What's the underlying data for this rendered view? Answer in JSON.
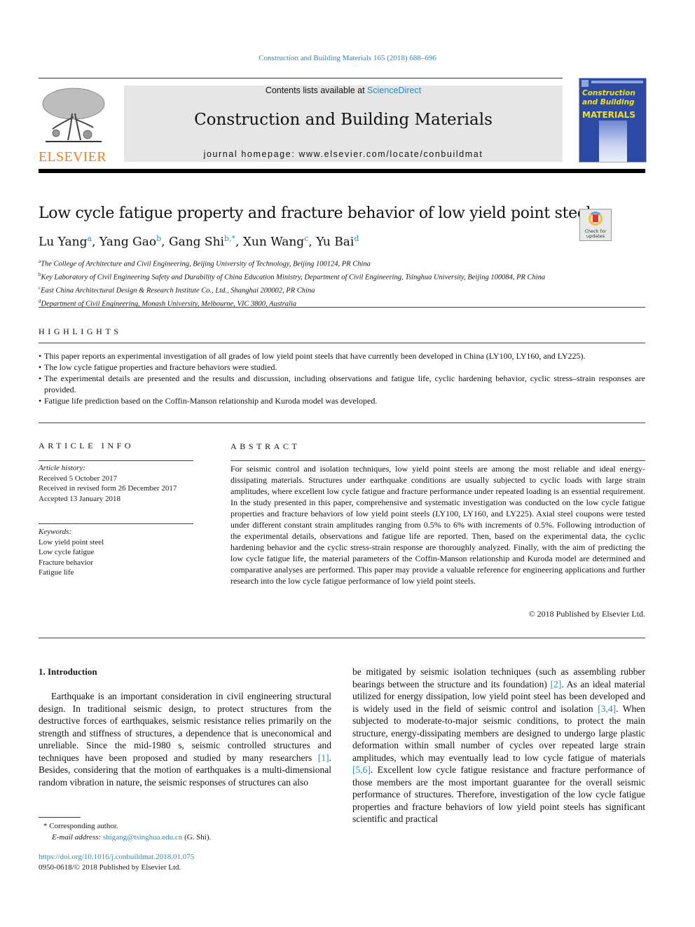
{
  "journal_ref": "Construction and Building Materials 165 (2018) 688–696",
  "header": {
    "publisher_logo": "ELSEVIER",
    "contents_prefix": "Contents lists available at ",
    "contents_link": "ScienceDirect",
    "journal_title": "Construction and Building Materials",
    "homepage": "journal homepage: www.elsevier.com/locate/conbuildmat",
    "cover": {
      "title_line1": "Construction",
      "title_line2": "and Building",
      "title_line3": "MATERIALS",
      "bg_color": "#2c4aa3",
      "title_color": "#f3e31c"
    },
    "publisher_color": "#f07f1d"
  },
  "article": {
    "title": "Low cycle fatigue property and fracture behavior of low yield point steels",
    "check_updates": [
      "Check for",
      "updates"
    ],
    "authors": [
      {
        "name": "Lu Yang",
        "sup": "a"
      },
      {
        "name": "Yang Gao",
        "sup": "b"
      },
      {
        "name": "Gang Shi",
        "sup": "b,*"
      },
      {
        "name": "Xun Wang",
        "sup": "c"
      },
      {
        "name": "Yu Bai",
        "sup": "d"
      }
    ],
    "affiliations": [
      {
        "sup": "a",
        "text": "The College of Architecture and Civil Engineering, Beijing University of Technology, Beijing 100124, PR China"
      },
      {
        "sup": "b",
        "text": "Key Laboratory of Civil Engineering Safety and Durability of China Education Ministry, Department of Civil Engineering, Tsinghua University, Beijing 100084, PR China"
      },
      {
        "sup": "c",
        "text": "East China Architectural Design & Research Institute Co., Ltd., Shanghai 200002, PR China"
      },
      {
        "sup": "d",
        "text": "Department of Civil Engineering, Monash University, Melbourne, VIC 3800, Australia"
      }
    ]
  },
  "highlights": {
    "heading": "HIGHLIGHTS",
    "items": [
      "This paper reports an experimental investigation of all grades of low yield point steels that have currently been developed in China (LY100, LY160, and LY225).",
      "The low cycle fatigue properties and fracture behaviors were studied.",
      "The experimental details are presented and the results and discussion, including observations and fatigue life, cyclic hardening behavior, cyclic stress–strain responses are provided.",
      "Fatigue life prediction based on the Coffin-Manson relationship and Kuroda model was developed."
    ]
  },
  "article_info": {
    "heading": "ARTICLE INFO",
    "history_label": "Article history:",
    "history": [
      "Received 5 October 2017",
      "Received in revised form 26 December 2017",
      "Accepted 13 January 2018"
    ],
    "keywords_label": "Keywords:",
    "keywords": [
      "Low yield point steel",
      "Low cycle fatigue",
      "Fracture behavior",
      "Fatigue life"
    ]
  },
  "abstract": {
    "heading": "ABSTRACT",
    "text": "For seismic control and isolation techniques, low yield point steels are among the most reliable and ideal energy-dissipating materials. Structures under earthquake conditions are usually subjected to cyclic loads with large strain amplitudes, where excellent low cycle fatigue and fracture performance under repeated loading is an essential requirement. In the study presented in this paper, comprehensive and systematic investigation was conducted on the low cycle fatigue properties and fracture behaviors of low yield point steels (LY100, LY160, and LY225). Axial steel coupons were tested under different constant strain amplitudes ranging from 0.5% to 6% with increments of 0.5%. Following introduction of the experimental details, observations and fatigue life are reported. Then, based on the experimental data, the cyclic hardening behavior and the cyclic stress-strain response are thoroughly analyzed. Finally, with the aim of predicting the low cycle fatigue life, the material parameters of the Coffin-Manson relationship and Kuroda model are determined and comparative analyses are performed. This paper may provide a valuable reference for engineering applications and further research into the low cycle fatigue performance of low yield point steels.",
    "copyright": "© 2018 Published by Elsevier Ltd."
  },
  "body": {
    "intro_heading": "1. Introduction",
    "left_col": {
      "p1": "Earthquake is an important consideration in civil engineering structural design. In traditional seismic design, to protect structures from the destructive forces of earthquakes, seismic resistance relies primarily on the strength and stiffness of structures, a dependence that is uneconomical and unreliable. Since the mid-1980 s, seismic controlled structures and techniques have been proposed and studied by many researchers ",
      "ref1": "[1]",
      "p2": ". Besides, considering that the motion of earthquakes is a multi-dimensional random vibration in nature, the seismic responses of structures can also"
    },
    "right_col": {
      "s1": "be mitigated by seismic isolation techniques (such as assembling rubber bearings between the structure and its foundation) ",
      "ref2": "[2]",
      "s2": ". As an ideal material utilized for energy dissipation, low yield point steel has been developed and is widely used in the field of seismic control and isolation ",
      "ref34": "[3,4]",
      "s3": ". When subjected to moderate-to-major seismic conditions, to protect the main structure, energy-dissipating members are designed to undergo large plastic deformation within small number of cycles over repeated large strain amplitudes, which may eventually lead to low cycle fatigue of materials ",
      "ref56": "[5,6]",
      "s4": ". Excellent low cycle fatigue resistance and fracture performance of those members are the most important guarantee for the overall seismic performance of structures. Therefore, investigation of the low cycle fatigue properties and fracture behaviors of low yield point steels has significant scientific and practical"
    }
  },
  "footnotes": {
    "corresponding": "* Corresponding author.",
    "email_label": "E-mail address: ",
    "email": "shigang@tsinghua.edu.cn",
    "email_suffix": " (G. Shi).",
    "doi": "https://doi.org/10.1016/j.conbuildmat.2018.01.075",
    "issn": "0950-0618/© 2018 Published by Elsevier Ltd."
  }
}
